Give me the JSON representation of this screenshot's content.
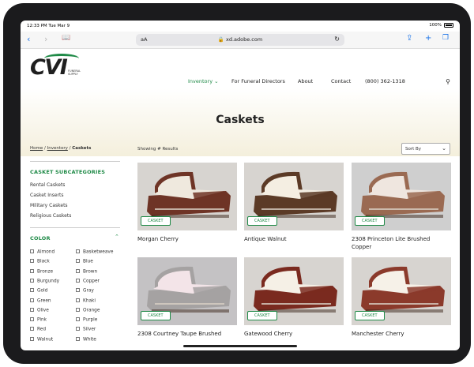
{
  "status": {
    "time": "12:33 PM  Tue Mar 9",
    "battery": "100%"
  },
  "browser": {
    "aa": "aA",
    "url": "🔒 xd.adobe.com"
  },
  "logo": {
    "text": "CVI",
    "sub": "FUNERAL SUPPLY"
  },
  "nav": {
    "items": [
      {
        "label": "Inventory ⌄",
        "active": true
      },
      {
        "label": "For Funeral Directors",
        "active": false
      },
      {
        "label": "About",
        "active": false
      },
      {
        "label": "Contact",
        "active": false
      },
      {
        "label": "(800) 362-1318",
        "active": false
      }
    ]
  },
  "hero": {
    "title": "Caskets"
  },
  "breadcrumb": {
    "home": "Home",
    "inventory": "Inventory",
    "current": "Caskets"
  },
  "results": {
    "showing": "Showing # Results",
    "sort_label": "Sort By"
  },
  "sidebar": {
    "subcat_title": "CASKET SUBCATEGORIES",
    "subcategories": [
      "Rental Caskets",
      "Casket Inserts",
      "Military Caskets",
      "Religious Caskets"
    ],
    "color_title": "COLOR",
    "colors_left": [
      "Almond",
      "Black",
      "Bronze",
      "Burgundy",
      "Gold",
      "Green",
      "Olive",
      "Pink",
      "Red",
      "Walnut"
    ],
    "colors_right": [
      "Basketweave",
      "Blue",
      "Brown",
      "Copper",
      "Gray",
      "Khaki",
      "Orange",
      "Purple",
      "Silver",
      "White"
    ]
  },
  "products": [
    {
      "name": "Morgan Cherry",
      "badge": "CASKET",
      "wood": "#6e3426",
      "lining": "#efe9de"
    },
    {
      "name": "Antique Walnut",
      "badge": "CASKET",
      "wood": "#5b3a26",
      "lining": "#f4eee2"
    },
    {
      "name": "2308 Princeton Lite Brushed Copper",
      "badge": "CASKET",
      "wood": "#9a6a52",
      "lining": "#efe6df"
    },
    {
      "name": "2308 Courtney Taupe Brushed",
      "badge": "CASKET",
      "wood": "#a5a2a2",
      "lining": "#f3e4e8"
    },
    {
      "name": "Gatewood Cherry",
      "badge": "CASKET",
      "wood": "#7a2a1f",
      "lining": "#f5f0e6"
    },
    {
      "name": "Manchester Cherry",
      "badge": "CASKET",
      "wood": "#8b3a2b",
      "lining": "#f6f1e8"
    }
  ],
  "colors": {
    "accent": "#1f8a47",
    "ios_blue": "#1a73e8"
  }
}
